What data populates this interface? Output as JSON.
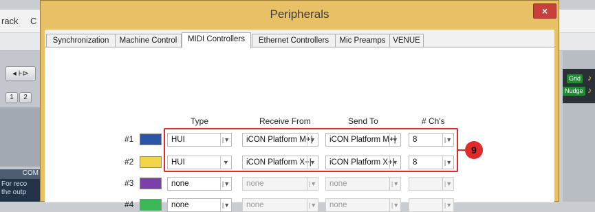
{
  "host": {
    "menu_items": [
      "rack",
      "C"
    ],
    "counter_buttons": [
      "1",
      "2"
    ],
    "com_label": "COM",
    "note_lines": [
      "For reco",
      "the outp"
    ],
    "grid_label": "Grid",
    "nudge_label": "Nudge"
  },
  "dialog": {
    "title": "Peripherals",
    "close_label": "×",
    "tabs": [
      {
        "label": "Synchronization",
        "active": false
      },
      {
        "label": "Machine Control",
        "active": false
      },
      {
        "label": "MIDI Controllers",
        "active": true
      },
      {
        "label": "Ethernet Controllers",
        "active": false
      },
      {
        "label": "Mic Preamps",
        "active": false
      },
      {
        "label": "VENUE",
        "active": false
      }
    ],
    "columns": {
      "type": "Type",
      "receive_from": "Receive From",
      "send_to": "Send To",
      "channels": "# Ch's"
    },
    "rows": [
      {
        "label": "#1",
        "color": "#2a56a8",
        "type": "HUI",
        "receive_from": "iCON Platform M+|",
        "send_to": "iCON Platform M+|",
        "channels": "8",
        "enabled": true
      },
      {
        "label": "#2",
        "color": "#f2d448",
        "type": "HUI",
        "receive_from": "iCON Platform X+|",
        "send_to": "iCON Platform X+|",
        "channels": "8",
        "enabled": true
      },
      {
        "label": "#3",
        "color": "#7d3fa8",
        "type": "none",
        "receive_from": "none",
        "send_to": "none",
        "channels": "",
        "enabled": false
      },
      {
        "label": "#4",
        "color": "#3cb855",
        "type": "none",
        "receive_from": "none",
        "send_to": "none",
        "channels": "",
        "enabled": false
      }
    ],
    "callout_number": "9",
    "accent_color": "#e02a2a"
  }
}
